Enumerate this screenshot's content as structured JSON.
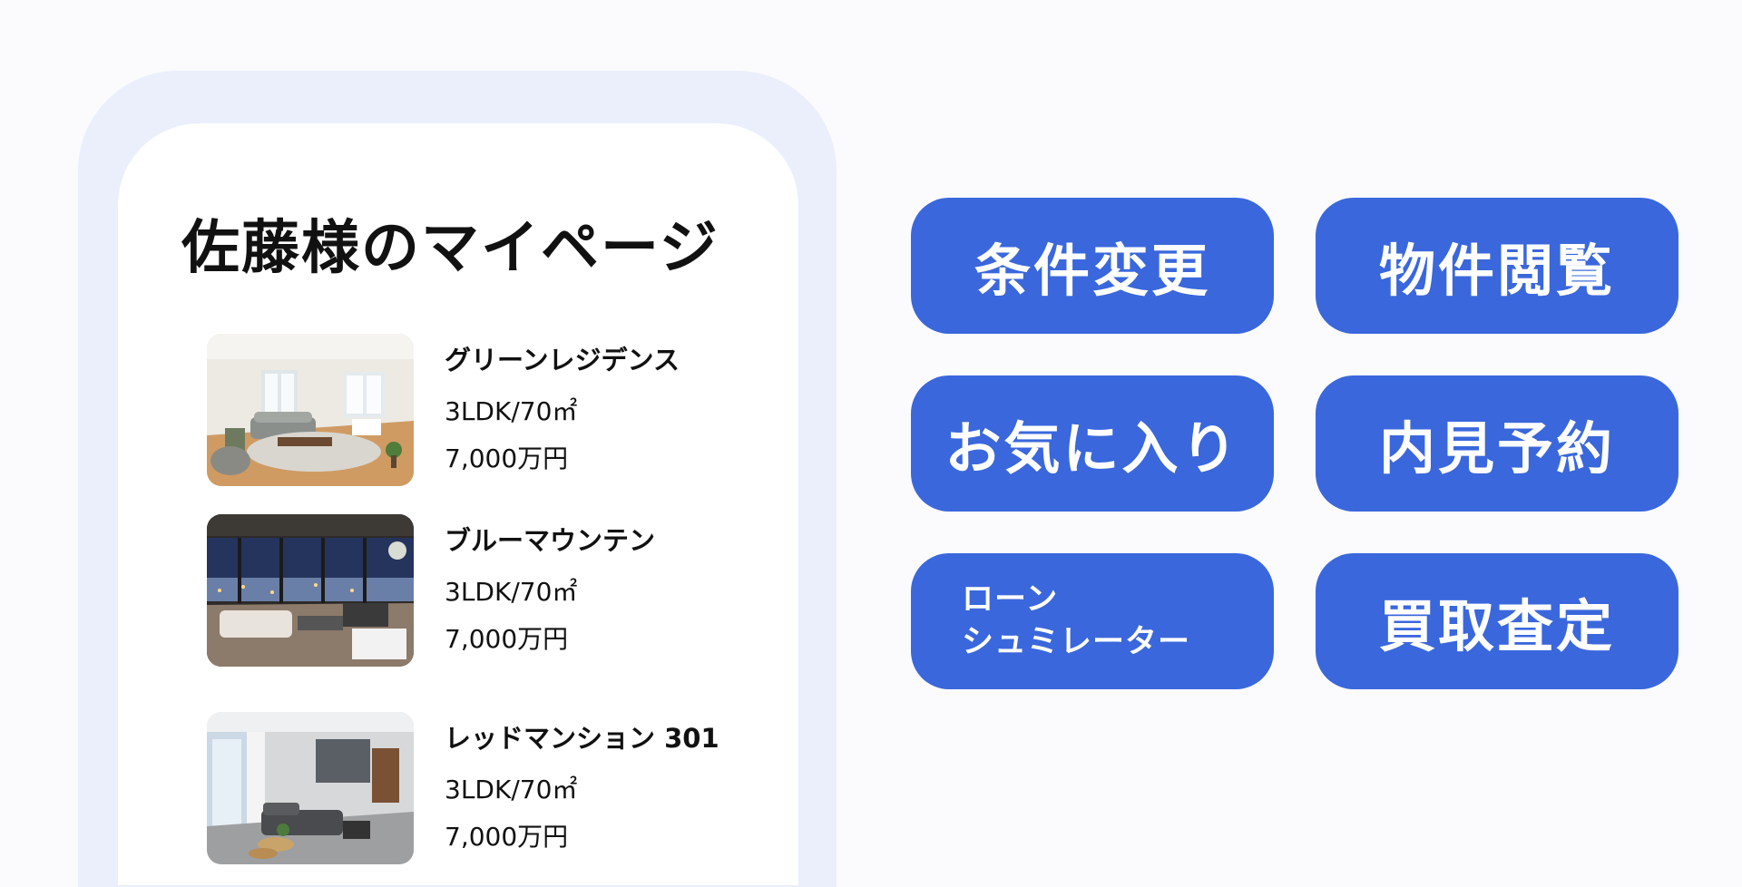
{
  "page": {
    "title": "佐藤様のマイページ"
  },
  "listings": [
    {
      "name": "グリーンレジデンス",
      "spec": "3LDK/70㎡",
      "price": "7,000万円",
      "image": "bright-living-room"
    },
    {
      "name": "ブルーマウンテン",
      "spec": "3LDK/70㎡",
      "price": "7,000万円",
      "image": "night-view-living-room"
    },
    {
      "name": "レッドマンション 301",
      "spec": "3LDK/70㎡",
      "price": "7,000万円",
      "image": "modern-living-room"
    }
  ],
  "actions": {
    "conditions": "条件変更",
    "browse": "物件閲覧",
    "favorites": "お気に入り",
    "viewing": "内見予約",
    "loan_line1": "ローン",
    "loan_line2": "シュミレーター",
    "appraisal": "買取査定"
  },
  "colors": {
    "accent": "#3a67dc",
    "frame": "#eaeffb",
    "background": "#fbfbfd"
  }
}
